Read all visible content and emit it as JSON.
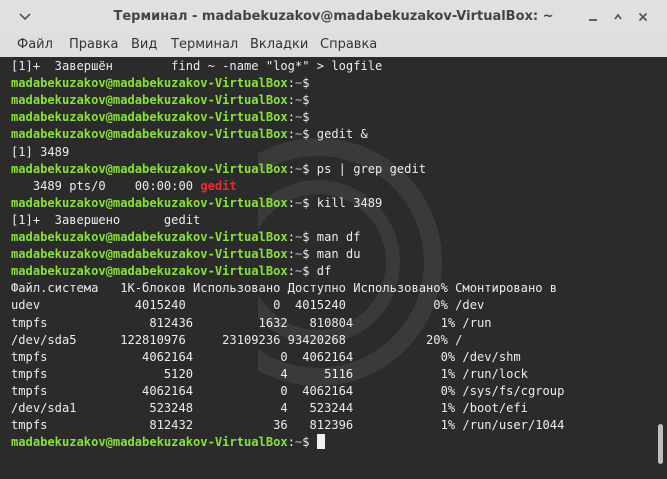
{
  "window": {
    "title": "Терминал - madabekuzakov@madabekuzakov-VirtualBox: ~",
    "collapse_icon": "chevron-down-icon",
    "minimize_icon": "minimize-icon",
    "maximize_icon": "maximize-icon",
    "close_icon": "close-icon"
  },
  "menubar": {
    "items": [
      "Файл",
      "Правка",
      "Вид",
      "Терминал",
      "Вкладки",
      "Справка"
    ]
  },
  "colors": {
    "prompt": "#8ae234",
    "path": "#729fcf",
    "highlight": "#ef2929",
    "background": "#2b2b2b"
  },
  "terminal": {
    "prompt_user": "madabekuzakov@madabekuzakov-VirtualBox",
    "path": "~",
    "lines": [
      {
        "type": "out",
        "text": "[1]+  Завершён        find ~ -name \"log*\" > logfile"
      },
      {
        "type": "prompt",
        "cmd": ""
      },
      {
        "type": "prompt",
        "cmd": ""
      },
      {
        "type": "prompt",
        "cmd": ""
      },
      {
        "type": "prompt",
        "cmd": " gedit &"
      },
      {
        "type": "out",
        "text": "[1] 3489"
      },
      {
        "type": "prompt",
        "cmd": " ps | grep gedit"
      },
      {
        "type": "out",
        "text": "   3489 pts/0    00:00:00 ",
        "highlight": "gedit"
      },
      {
        "type": "prompt",
        "cmd": " kill 3489"
      },
      {
        "type": "out",
        "text": "[1]+  Завершено      gedit"
      },
      {
        "type": "prompt",
        "cmd": " man df"
      },
      {
        "type": "prompt",
        "cmd": " man du"
      },
      {
        "type": "prompt",
        "cmd": " df"
      },
      {
        "type": "out",
        "text": "Файл.система   1K-блоков Использовано Доступно Использовано% Смонтировано в"
      },
      {
        "type": "out",
        "text": "udev             4015240            0  4015240            0% /dev"
      },
      {
        "type": "out",
        "text": "tmpfs              812436         1632   810804            1% /run"
      },
      {
        "type": "out",
        "text": "/dev/sda5      122810976     23109236 93420268           20% /"
      },
      {
        "type": "out",
        "text": "tmpfs             4062164            0  4062164            0% /dev/shm"
      },
      {
        "type": "out",
        "text": "tmpfs                5120            4     5116            1% /run/lock"
      },
      {
        "type": "out",
        "text": "tmpfs             4062164            0  4062164            0% /sys/fs/cgroup"
      },
      {
        "type": "out",
        "text": "/dev/sda1          523248            4   523244            1% /boot/efi"
      },
      {
        "type": "out",
        "text": "tmpfs              812432           36   812396            1% /run/user/1044"
      },
      {
        "type": "prompt",
        "cmd": " ",
        "cursor": true
      }
    ]
  }
}
